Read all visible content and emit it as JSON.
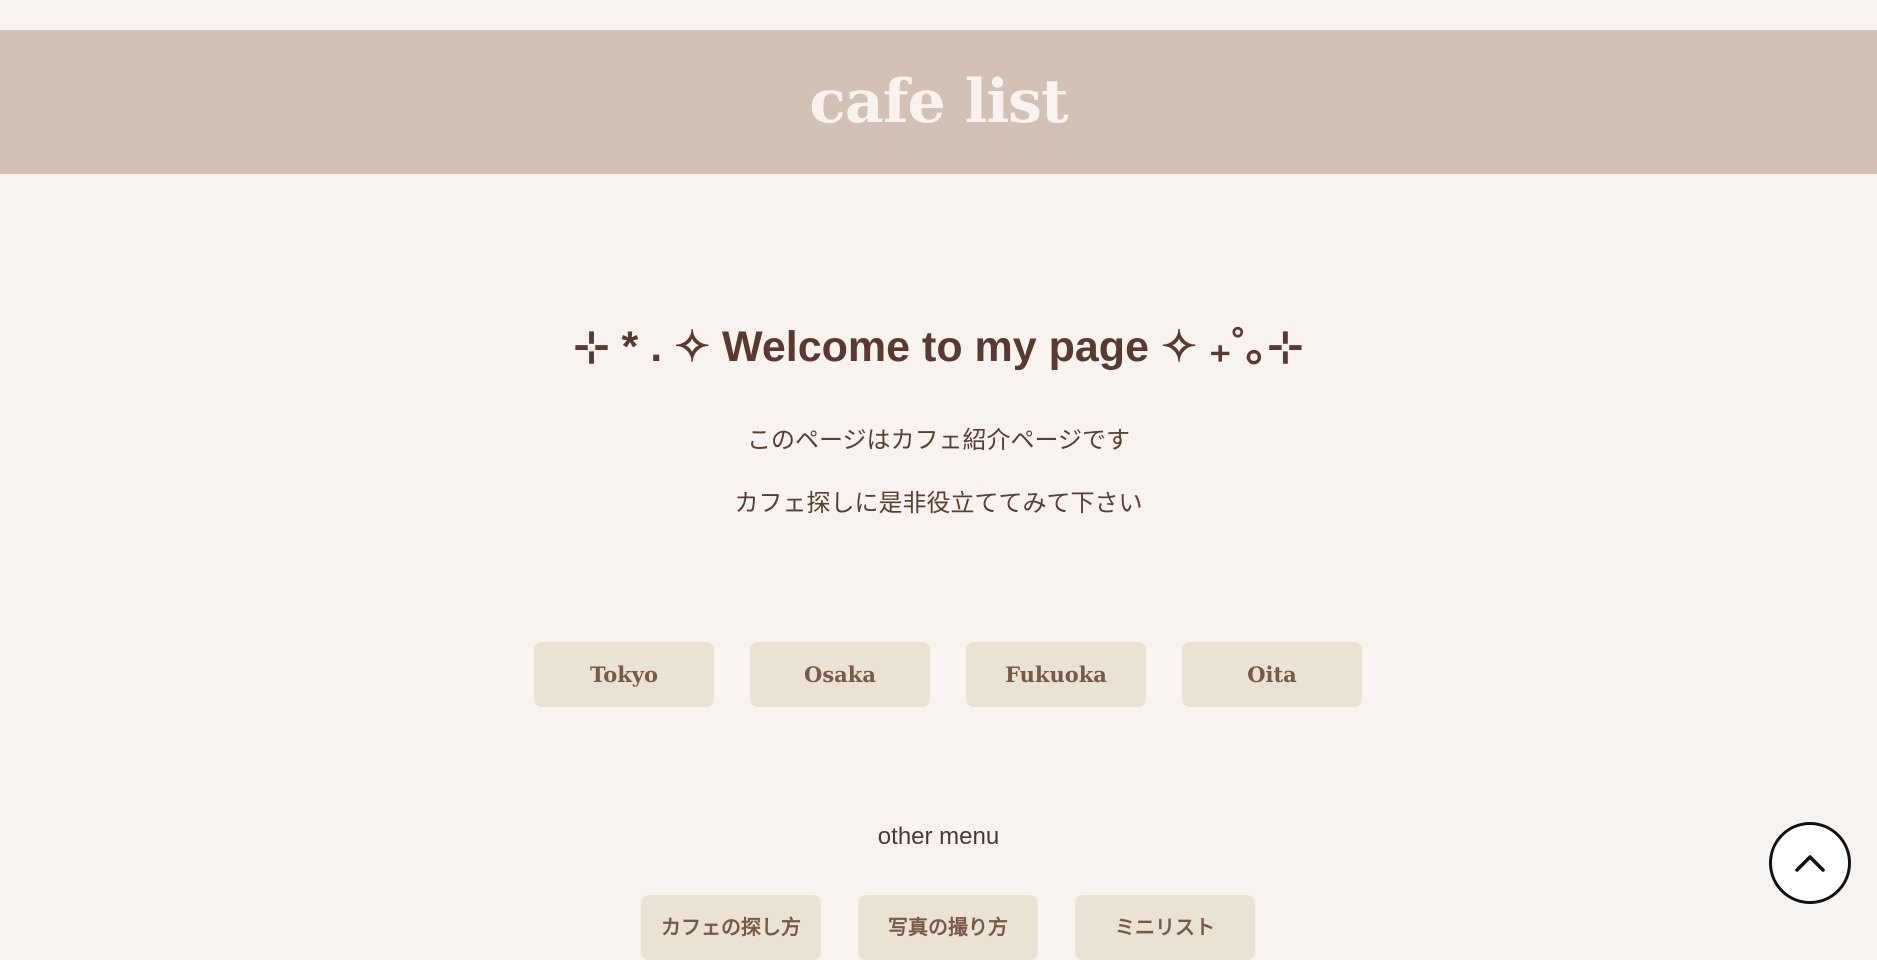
{
  "header": {
    "title": "cafe list",
    "background": "#d2c1b4"
  },
  "welcome": {
    "heading": "⊹ * . ✧ Welcome to my page ✧ ₊˚｡⊹"
  },
  "description": {
    "line1": "このページはカフェ紹介ページです",
    "line2": "カフェ探しに是非役立ててみて下さい"
  },
  "cities": [
    {
      "label": "Tokyo"
    },
    {
      "label": "Osaka"
    },
    {
      "label": "Fukuoka"
    },
    {
      "label": "Oita"
    }
  ],
  "other_menu": {
    "title": "other menu",
    "items": [
      {
        "label": "カフェの探し方"
      },
      {
        "label": "写真の撮り方"
      },
      {
        "label": "ミニリスト"
      }
    ]
  },
  "scroll_top": {
    "icon": "chevron-up-icon"
  },
  "colors": {
    "page_background": "#f8f3ef",
    "button_background": "#ebe2d6",
    "text_brown": "#5a3e30"
  }
}
